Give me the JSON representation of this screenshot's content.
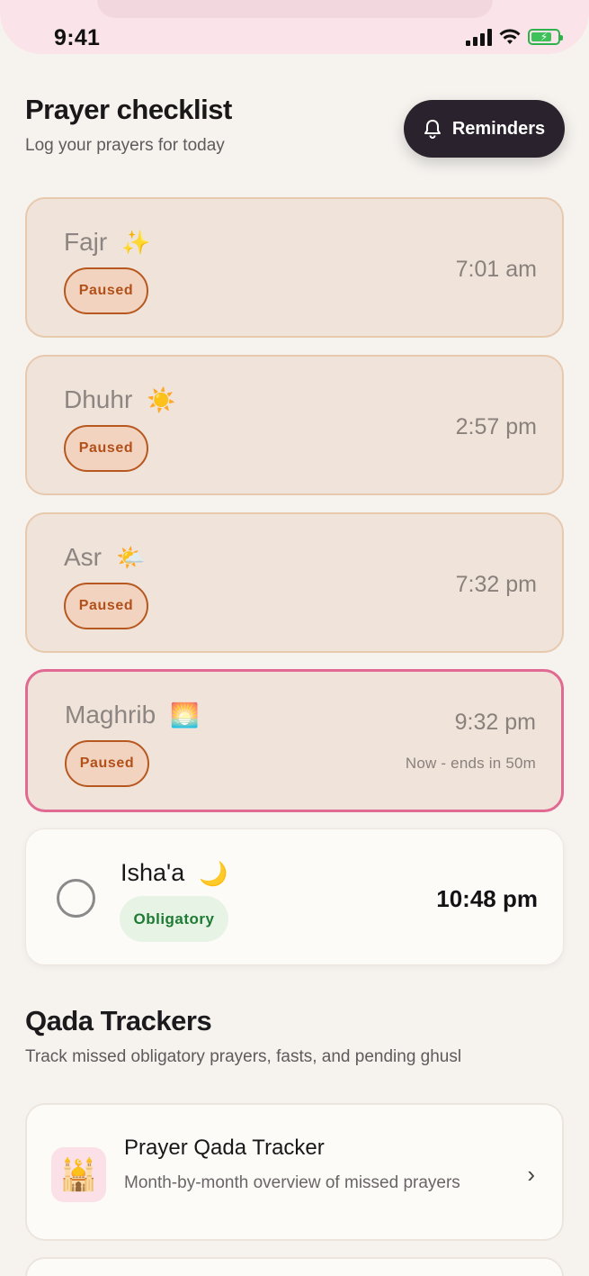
{
  "status_bar": {
    "time": "9:41"
  },
  "header": {
    "title": "Prayer checklist",
    "subtitle": "Log your prayers for today",
    "reminders_label": "Reminders"
  },
  "prayers": [
    {
      "name": "Fajr",
      "emoji": "✨",
      "badge": "Paused",
      "time": "7:01 am"
    },
    {
      "name": "Dhuhr",
      "emoji": "☀️",
      "badge": "Paused",
      "time": "2:57 pm"
    },
    {
      "name": "Asr",
      "emoji": "🌤️",
      "badge": "Paused",
      "time": "7:32 pm"
    },
    {
      "name": "Maghrib",
      "emoji": "🌅",
      "badge": "Paused",
      "time": "9:32 pm",
      "note": "Now - ends in 50m"
    }
  ],
  "isha": {
    "name": "Isha'a",
    "emoji": "🌙",
    "badge": "Obligatory",
    "time": "10:48 pm"
  },
  "qada": {
    "title": "Qada Trackers",
    "subtitle": "Track missed obligatory prayers, fasts, and pending ghusl"
  },
  "trackers": [
    {
      "icon": "🕌",
      "title": "Prayer Qada Tracker",
      "description": "Month-by-month overview of missed prayers"
    }
  ],
  "colors": {
    "accent_dark": "#2a222c",
    "paused": "#b2501a",
    "active_border": "#e06a91",
    "obligatory": "#1f7a34"
  }
}
